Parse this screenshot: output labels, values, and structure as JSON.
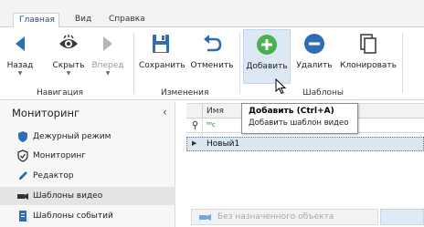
{
  "tabs": [
    "Главная",
    "Вид",
    "Справка"
  ],
  "ribbon": {
    "buttons": {
      "back": "Назад",
      "hide": "Скрыть",
      "forward": "Вперед",
      "save": "Сохранить",
      "cancel": "Отменить",
      "add": "Добавить",
      "remove": "Удалить",
      "clone": "Клонировать"
    },
    "groups": {
      "navigation": "Навигация",
      "changes": "Изменения",
      "templates": "Шаблоны"
    },
    "accent": "#2f6db5",
    "add_color": "#4caf50"
  },
  "tooltip": {
    "title": "Добавить (Ctrl+A)",
    "description": "Добавить шаблон видео"
  },
  "sidebar": {
    "title": "Мониторинг",
    "collapse_glyph": "‹",
    "items": [
      {
        "label": "Дежурный режим",
        "icon": "shield-icon"
      },
      {
        "label": "Мониторинг",
        "icon": "check-shield-icon"
      },
      {
        "label": "Редактор",
        "icon": "pencil-icon"
      },
      {
        "label": "Шаблоны видео",
        "icon": "video-camera-icon",
        "selected": true
      },
      {
        "label": "Шаблоны событий",
        "icon": "document-icon"
      }
    ]
  },
  "grid": {
    "column": "Имя",
    "filter_tag": "ᴮᴮc",
    "rows": [
      "Новый1"
    ]
  },
  "object_bar": {
    "label": "Без назначенного объекта"
  }
}
